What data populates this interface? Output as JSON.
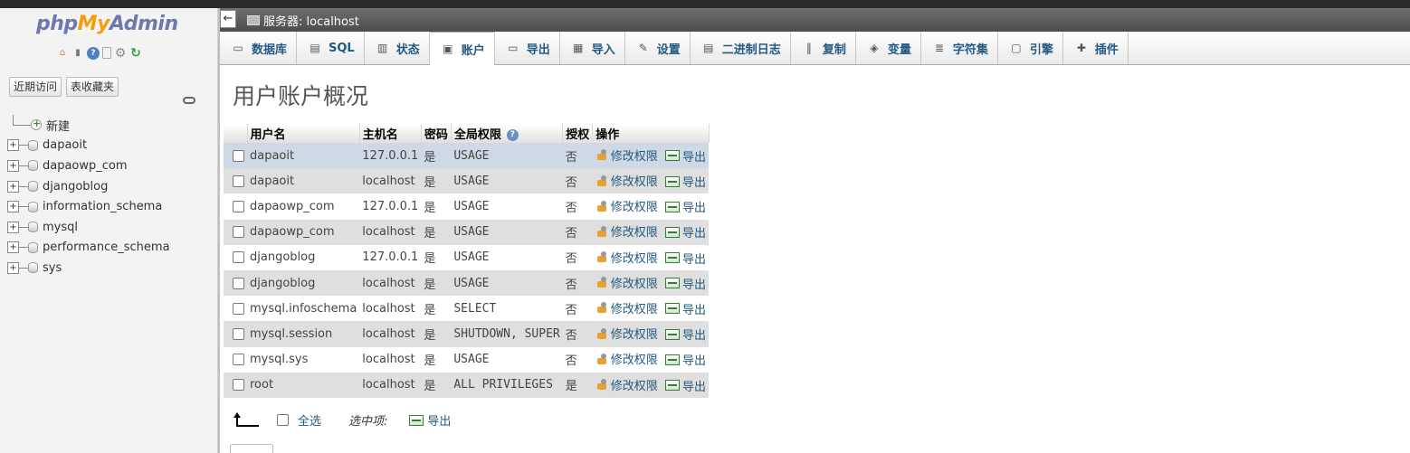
{
  "logo": {
    "php": "php",
    "my": "My",
    "admin": "Admin"
  },
  "nav": {
    "recent_label": "近期访问",
    "favorites_label": "表收藏夹"
  },
  "tree": {
    "new_label": "新建",
    "databases": [
      "dapaoit",
      "dapaowp_com",
      "djangoblog",
      "information_schema",
      "mysql",
      "performance_schema",
      "sys"
    ]
  },
  "server": {
    "collapse_glyph": "←",
    "breadcrumb": "服务器: localhost"
  },
  "tabs": [
    {
      "label": "数据库",
      "icon": "database-icon",
      "glyph": "▭"
    },
    {
      "label": "SQL",
      "icon": "sql-icon",
      "glyph": "▤"
    },
    {
      "label": "状态",
      "icon": "status-chart-icon",
      "glyph": "▥"
    },
    {
      "label": "账户",
      "icon": "accounts-icon",
      "glyph": "▣"
    },
    {
      "label": "导出",
      "icon": "export-icon",
      "glyph": "▭"
    },
    {
      "label": "导入",
      "icon": "import-icon",
      "glyph": "▦"
    },
    {
      "label": "设置",
      "icon": "wrench-icon",
      "glyph": "✎"
    },
    {
      "label": "二进制日志",
      "icon": "binlog-icon",
      "glyph": "▤"
    },
    {
      "label": "复制",
      "icon": "replication-icon",
      "glyph": "‖"
    },
    {
      "label": "变量",
      "icon": "variables-icon",
      "glyph": "◈"
    },
    {
      "label": "字符集",
      "icon": "charset-icon",
      "glyph": "≣"
    },
    {
      "label": "引擎",
      "icon": "engine-icon",
      "glyph": "▢"
    },
    {
      "label": "插件",
      "icon": "plugin-icon",
      "glyph": "✚"
    }
  ],
  "active_tab": "账户",
  "page_title": "用户账户概况",
  "table": {
    "headers": {
      "user": "用户名",
      "host": "主机名",
      "password": "密码",
      "privileges": "全局权限",
      "grant": "授权",
      "action": "操作"
    },
    "edit_label": "修改权限",
    "export_label": "导出",
    "rows": [
      {
        "user": "dapaoit",
        "host": "127.0.0.1",
        "password": "是",
        "privileges": "USAGE",
        "grant": "否"
      },
      {
        "user": "dapaoit",
        "host": "localhost",
        "password": "是",
        "privileges": "USAGE",
        "grant": "否"
      },
      {
        "user": "dapaowp_com",
        "host": "127.0.0.1",
        "password": "是",
        "privileges": "USAGE",
        "grant": "否"
      },
      {
        "user": "dapaowp_com",
        "host": "localhost",
        "password": "是",
        "privileges": "USAGE",
        "grant": "否"
      },
      {
        "user": "djangoblog",
        "host": "127.0.0.1",
        "password": "是",
        "privileges": "USAGE",
        "grant": "否"
      },
      {
        "user": "djangoblog",
        "host": "localhost",
        "password": "是",
        "privileges": "USAGE",
        "grant": "否"
      },
      {
        "user": "mysql.infoschema",
        "host": "localhost",
        "password": "是",
        "privileges": "SELECT",
        "grant": "否"
      },
      {
        "user": "mysql.session",
        "host": "localhost",
        "password": "是",
        "privileges": "SHUTDOWN, SUPER",
        "grant": "否"
      },
      {
        "user": "mysql.sys",
        "host": "localhost",
        "password": "是",
        "privileges": "USAGE",
        "grant": "否"
      },
      {
        "user": "root",
        "host": "localhost",
        "password": "是",
        "privileges": "ALL PRIVILEGES",
        "grant": "是"
      }
    ]
  },
  "bottom": {
    "select_all": "全选",
    "with_selected": "选中项:",
    "export_label": "导出"
  },
  "colors": {
    "link": "#235a81",
    "selected_row": "#ced9e5",
    "even_row": "#dfdfdf",
    "logo_orange": "#f89c0e",
    "logo_blue": "#6c78af"
  }
}
